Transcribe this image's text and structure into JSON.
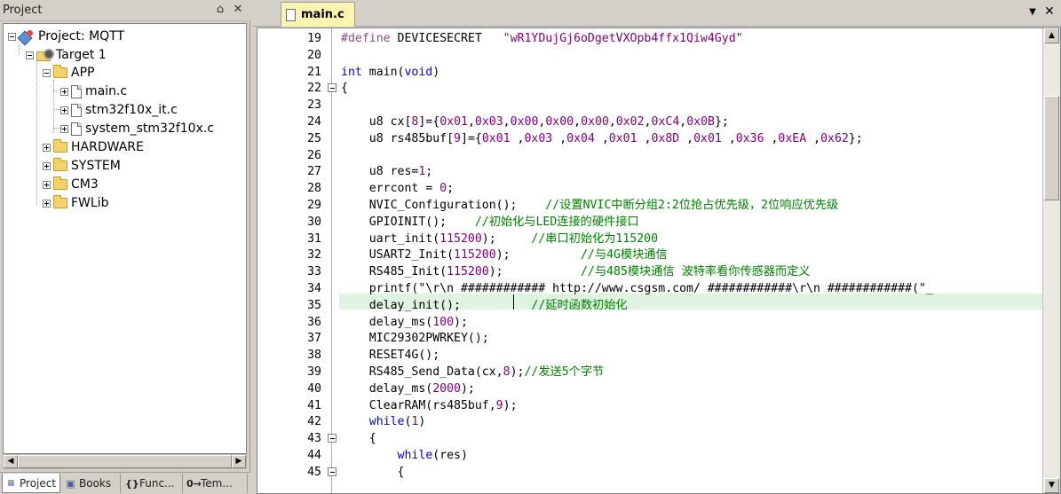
{
  "project_panel": {
    "title": "Project",
    "pin_glyph": "⌂",
    "close_glyph": "✕",
    "tree": {
      "project": "Project: MQTT",
      "target": "Target 1",
      "groups": [
        {
          "name": "APP",
          "expanded": true,
          "files": [
            "main.c",
            "stm32f10x_it.c",
            "system_stm32f10x.c"
          ]
        },
        {
          "name": "HARDWARE",
          "expanded": false
        },
        {
          "name": "SYSTEM",
          "expanded": false
        },
        {
          "name": "CM3",
          "expanded": false
        },
        {
          "name": "FWLib",
          "expanded": false
        }
      ]
    },
    "scroll_left_glyph": "◀",
    "scroll_right_glyph": "▶",
    "tabs": [
      {
        "label": "Project",
        "icon": "project-tab-icon",
        "glyph": "≡",
        "active": true
      },
      {
        "label": "Books",
        "icon": "books-icon",
        "glyph": "▣",
        "active": false
      },
      {
        "label": "Func...",
        "icon": "functions-icon",
        "glyph": "{}",
        "active": false
      },
      {
        "label": "Tem...",
        "icon": "templates-icon",
        "glyph": "0→",
        "active": false
      }
    ]
  },
  "editor": {
    "tab_label": "main.c",
    "dropdown_glyph": "▼",
    "close_glyph": "✕",
    "scroll_up_glyph": "▲",
    "scroll_down_glyph": "▼",
    "colors": {
      "keyword": "#0000ff",
      "comment": "#008000",
      "number": "#800080",
      "current_line": "#e0f2e2"
    },
    "lines": [
      {
        "n": "19",
        "parts": [
          [
            "pp",
            "#define"
          ],
          [
            "",
            " DEVICESECRET   "
          ],
          [
            "str",
            "\"wR1YDujGj6oDgetVXOpb4ffx1Qiw4Gyd\""
          ]
        ]
      },
      {
        "n": "20",
        "parts": []
      },
      {
        "n": "21",
        "parts": [
          [
            "kw",
            "int"
          ],
          [
            "",
            " main("
          ],
          [
            "kw",
            "void"
          ],
          [
            "",
            ")"
          ]
        ]
      },
      {
        "n": "22",
        "fold": true,
        "parts": [
          [
            "",
            "{"
          ]
        ]
      },
      {
        "n": "23",
        "parts": []
      },
      {
        "n": "24",
        "parts": [
          [
            "",
            "    u8 cx["
          ],
          [
            "num",
            "8"
          ],
          [
            "",
            "]={"
          ],
          [
            "num",
            "0x01"
          ],
          [
            "",
            ","
          ],
          [
            "num",
            "0x03"
          ],
          [
            "",
            ","
          ],
          [
            "num",
            "0x00"
          ],
          [
            "",
            ","
          ],
          [
            "num",
            "0x00"
          ],
          [
            "",
            ","
          ],
          [
            "num",
            "0x00"
          ],
          [
            "",
            ","
          ],
          [
            "num",
            "0x02"
          ],
          [
            "",
            ","
          ],
          [
            "num",
            "0xC4"
          ],
          [
            "",
            ","
          ],
          [
            "num",
            "0x0B"
          ],
          [
            "",
            "};"
          ]
        ]
      },
      {
        "n": "25",
        "parts": [
          [
            "",
            "    u8 rs485buf["
          ],
          [
            "num",
            "9"
          ],
          [
            "",
            "]={"
          ],
          [
            "num",
            "0x01"
          ],
          [
            "",
            " ,"
          ],
          [
            "num",
            "0x03"
          ],
          [
            "",
            " ,"
          ],
          [
            "num",
            "0x04"
          ],
          [
            "",
            " ,"
          ],
          [
            "num",
            "0x01"
          ],
          [
            "",
            " ,"
          ],
          [
            "num",
            "0x8D"
          ],
          [
            "",
            " ,"
          ],
          [
            "num",
            "0x01"
          ],
          [
            "",
            " ,"
          ],
          [
            "num",
            "0x36"
          ],
          [
            "",
            " ,"
          ],
          [
            "num",
            "0xEA"
          ],
          [
            "",
            " ,"
          ],
          [
            "num",
            "0x62"
          ],
          [
            "",
            "};"
          ]
        ]
      },
      {
        "n": "26",
        "parts": []
      },
      {
        "n": "27",
        "parts": [
          [
            "",
            "    u8 res="
          ],
          [
            "num",
            "1"
          ],
          [
            "",
            ";"
          ]
        ]
      },
      {
        "n": "28",
        "parts": [
          [
            "",
            "    errcont = "
          ],
          [
            "num",
            "0"
          ],
          [
            "",
            ";"
          ]
        ]
      },
      {
        "n": "29",
        "parts": [
          [
            "",
            "    NVIC_Configuration();    "
          ],
          [
            "cm",
            "//设置NVIC中断分组2:2位抢占优先级，2位响应优先级"
          ]
        ]
      },
      {
        "n": "30",
        "parts": [
          [
            "",
            "    GPIOINIT();    "
          ],
          [
            "cm",
            "//初始化与LED连接的硬件接口"
          ]
        ]
      },
      {
        "n": "31",
        "parts": [
          [
            "",
            "    uart_init("
          ],
          [
            "num",
            "115200"
          ],
          [
            "",
            ");     "
          ],
          [
            "cm",
            "//串口初始化为115200"
          ]
        ]
      },
      {
        "n": "32",
        "parts": [
          [
            "",
            "    USART2_Init("
          ],
          [
            "num",
            "115200"
          ],
          [
            "",
            ");          "
          ],
          [
            "cm",
            "//与4G模块通信"
          ]
        ]
      },
      {
        "n": "33",
        "parts": [
          [
            "",
            "    RS485_Init("
          ],
          [
            "num",
            "115200"
          ],
          [
            "",
            ");           "
          ],
          [
            "cm",
            "//与485模块通信 波特率看你传感器而定义"
          ]
        ]
      },
      {
        "n": "34",
        "parts": [
          [
            "",
            "    printf(\"\\r\\n ############ http://www.csgsm.com/ ############\\r\\n ############(\"_"
          ]
        ]
      },
      {
        "n": "35",
        "current": true,
        "parts": [
          [
            "",
            "    delay_init();          "
          ],
          [
            "cm",
            "//延时函数初始化"
          ]
        ]
      },
      {
        "n": "36",
        "parts": [
          [
            "",
            "    delay_ms("
          ],
          [
            "num",
            "100"
          ],
          [
            "",
            ");"
          ]
        ]
      },
      {
        "n": "37",
        "parts": [
          [
            "",
            "    MIC29302PWRKEY();"
          ]
        ]
      },
      {
        "n": "38",
        "parts": [
          [
            "",
            "    RESET4G();"
          ]
        ]
      },
      {
        "n": "39",
        "parts": [
          [
            "",
            "    RS485_Send_Data(cx,"
          ],
          [
            "num",
            "8"
          ],
          [
            "",
            ");"
          ],
          [
            "cm",
            "//发送5个字节"
          ]
        ]
      },
      {
        "n": "40",
        "parts": [
          [
            "",
            "    delay_ms("
          ],
          [
            "num",
            "2000"
          ],
          [
            "",
            ");"
          ]
        ]
      },
      {
        "n": "41",
        "parts": [
          [
            "",
            "    ClearRAM(rs485buf,"
          ],
          [
            "num",
            "9"
          ],
          [
            "",
            ");"
          ]
        ]
      },
      {
        "n": "42",
        "parts": [
          [
            "",
            "    "
          ],
          [
            "kw",
            "while"
          ],
          [
            "",
            "("
          ],
          [
            "num",
            "1"
          ],
          [
            "",
            ")"
          ]
        ]
      },
      {
        "n": "43",
        "fold": true,
        "parts": [
          [
            "",
            "    {"
          ]
        ]
      },
      {
        "n": "44",
        "parts": [
          [
            "",
            "        "
          ],
          [
            "kw",
            "while"
          ],
          [
            "",
            "(res)"
          ]
        ]
      },
      {
        "n": "45",
        "fold": true,
        "parts": [
          [
            "",
            "        {"
          ]
        ]
      }
    ]
  }
}
